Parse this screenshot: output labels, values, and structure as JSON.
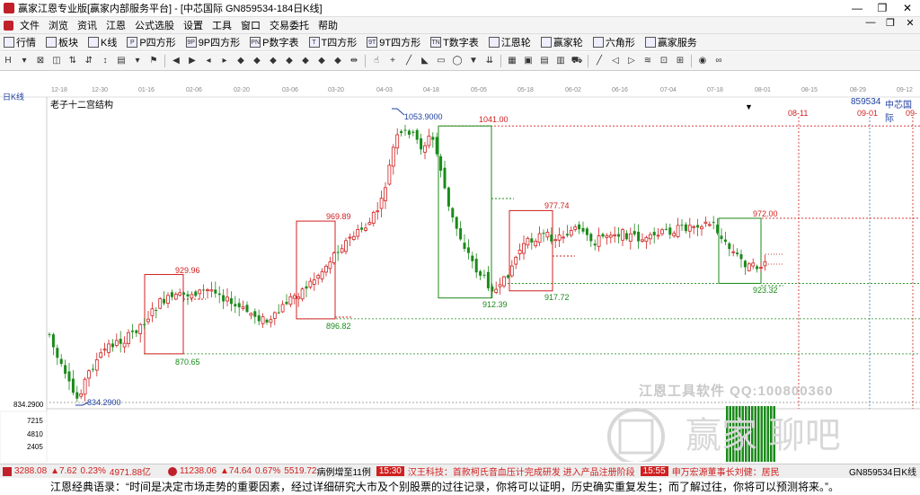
{
  "window": {
    "title": "赢家江恩专业版[赢家内部服务平台] - [中芯国际  GN859534-184日K线]",
    "controls": [
      "—",
      "❐",
      "✕"
    ]
  },
  "menu": {
    "items": [
      "文件",
      "浏览",
      "资讯",
      "江恩",
      "公式选股",
      "设置",
      "工具",
      "窗口",
      "交易委托",
      "帮助"
    ],
    "right_controls": [
      "—",
      "❐",
      "✕"
    ]
  },
  "toolbar1": {
    "items": [
      {
        "icon": "grid-icon",
        "label": "行情"
      },
      {
        "icon": "blocks-icon",
        "label": "板块"
      },
      {
        "icon": "kline-icon",
        "label": "K线"
      },
      {
        "icon": "P",
        "label": "P四方形"
      },
      {
        "icon": "9P",
        "label": "9P四方形"
      },
      {
        "icon": "PN",
        "label": "P数字表"
      },
      {
        "icon": "T",
        "label": "T四方形"
      },
      {
        "icon": "9T",
        "label": "9T四方形"
      },
      {
        "icon": "TN",
        "label": "T数字表"
      },
      {
        "icon": "wheel-icon",
        "label": "江恩轮"
      },
      {
        "icon": "wheel2-icon",
        "label": "赢家轮"
      },
      {
        "icon": "star-icon",
        "label": "六角形"
      },
      {
        "icon": "service-icon",
        "label": "赢家服务"
      }
    ]
  },
  "chart_header": {
    "period_label": "日K线",
    "indicator_name": "老子十二宫结构",
    "code": "859534",
    "name": "中芯国际",
    "dropdown": "▼"
  },
  "date_axis": [
    "12-18",
    "12-30",
    "01-16",
    "02-06",
    "02-20",
    "03-06",
    "03-20",
    "04-03",
    "04-18",
    "05-05",
    "05-18",
    "06-02",
    "06-16",
    "07-04",
    "07-18",
    "08-01",
    "08-15",
    "08-29",
    "09-12"
  ],
  "future_dates": [
    "08-11",
    "09-01",
    "09-"
  ],
  "left_axis": {
    "price_label": "834.2900",
    "volume_ticks": [
      "7215",
      "4810",
      "2405"
    ]
  },
  "chart_data": {
    "type": "candlestick",
    "price_annotations": [
      "1053.9000",
      "1041.00",
      "977.74",
      "972.00",
      "969.89",
      "929.96",
      "923.32",
      "917.72",
      "912.39",
      "896.82",
      "870.65",
      "834.2900"
    ]
  },
  "watermark": {
    "text": "江恩工具软件  QQ:100800360",
    "logo": "赢家 聊吧"
  },
  "statusbar": {
    "sh": "3288.08",
    "sh_chg": "▲7.62",
    "sh_pct": "0.23%",
    "sh_amt": "4971.88亿",
    "sz": "11238.06",
    "sz_chg": "▲74.64",
    "sz_pct": "0.67%",
    "sz_amt": "5519.72",
    "news1": "病例增至11例",
    "time1": "15:30",
    "news2": "汉王科技：首款柯氏音血压计完成研发 进入产品注册阶段",
    "time2": "15:55",
    "news3": "申万宏源董事长刘健：居民",
    "right": "GN859534日K线"
  },
  "quote": "江恩经典语录：“时间是决定市场走势的重要因素，经过详细研究大市及个别股票的过往记录，你将可以证明，历史确实重复发生；而了解过往，你将可以预测将来。”。",
  "colors": {
    "up": "#d02020",
    "down": "#1a8a1a",
    "box_red": "#d02020",
    "box_green": "#1a8a1a"
  }
}
